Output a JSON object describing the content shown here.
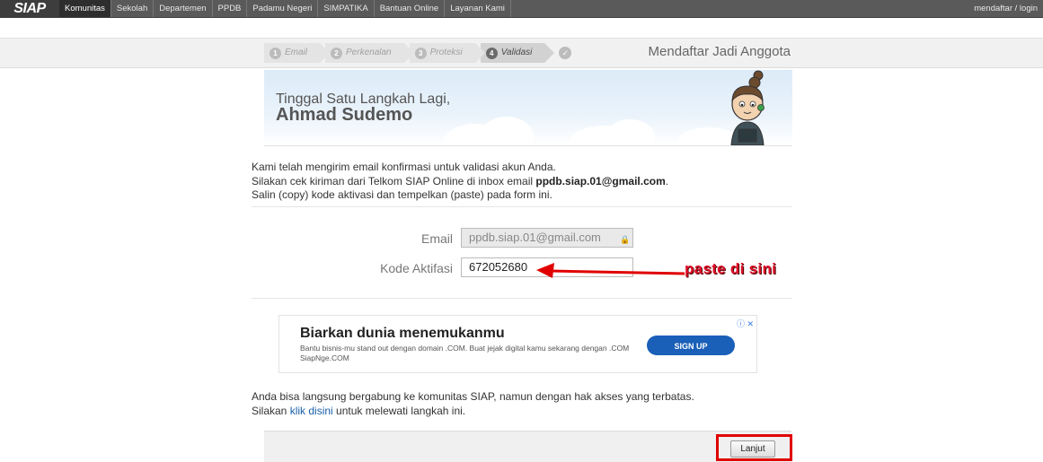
{
  "nav": {
    "logo": "SIAP",
    "items": [
      {
        "label": "Komunitas",
        "active": true
      },
      {
        "label": "Sekolah"
      },
      {
        "label": "Departemen"
      },
      {
        "label": "PPDB"
      },
      {
        "label": "Padamu Negeri"
      },
      {
        "label": "SIMPATIKA"
      },
      {
        "label": "Bantuan Online"
      },
      {
        "label": "Layanan Kami"
      }
    ],
    "login": "mendaftar / login"
  },
  "steps": [
    {
      "num": "1",
      "label": "Email"
    },
    {
      "num": "2",
      "label": "Perkenalan"
    },
    {
      "num": "3",
      "label": "Proteksi"
    },
    {
      "num": "4",
      "label": "Validasi"
    }
  ],
  "step_check": "✓",
  "step_title": "Mendaftar Jadi Anggota",
  "hero": {
    "line1": "Tinggal Satu Langkah Lagi,",
    "name": "Ahmad Sudemo"
  },
  "intro": {
    "line1": "Kami telah mengirim email konfirmasi untuk validasi akun Anda.",
    "line2_pre": "Silakan cek kiriman dari Telkom SIAP Online di inbox email ",
    "email": "ppdb.siap.01@gmail.com",
    "line2_post": ".",
    "line3": "Salin (copy) kode aktivasi dan tempelkan (paste) pada form ini."
  },
  "form": {
    "email_label": "Email",
    "email_value": "ppdb.siap.01@gmail.com",
    "code_label": "Kode Aktifasi",
    "code_value": "672052680"
  },
  "annotation": {
    "text": "paste di sini",
    "color": "#e0102a"
  },
  "ad": {
    "title": "Biarkan dunia menemukanmu",
    "text": "Bantu bisnis-mu stand out dengan domain .COM. Buat jejak digital kamu sekarang dengan .COM SiapNge.COM",
    "button": "SIGN UP",
    "ctrl": "ⓘ ✕"
  },
  "outro": {
    "line1": "Anda bisa langsung bergabung ke komunitas SIAP, namun dengan hak akses yang terbatas.",
    "line2_pre": "Silakan ",
    "link": "klik disini",
    "line2_post": " untuk melewati langkah ini."
  },
  "footer": {
    "button": "Lanjut"
  },
  "colors": {
    "nav_bg": "#5a5a5a",
    "accent_red": "#e00000",
    "link": "#1a5faa",
    "ad_button": "#1a5fb8"
  }
}
